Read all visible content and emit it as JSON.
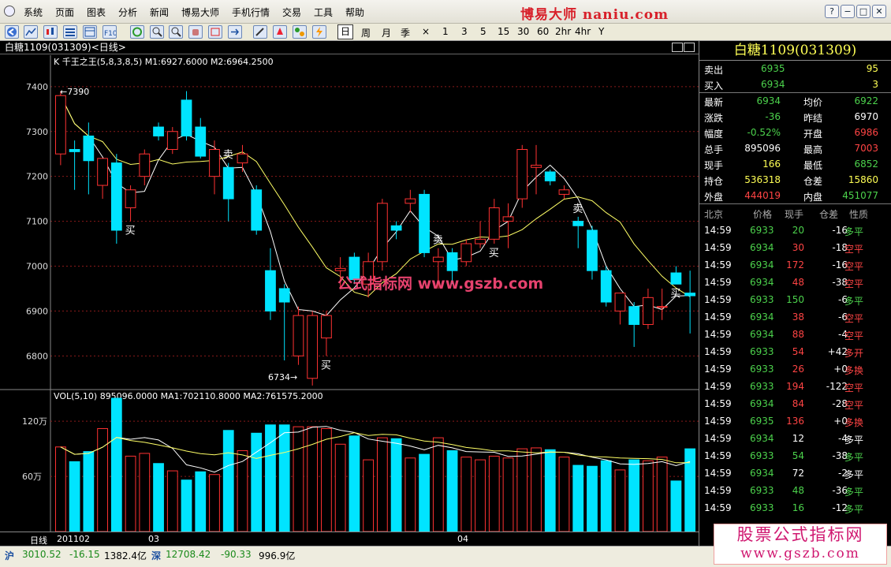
{
  "menu": {
    "items": [
      "系统",
      "页面",
      "图表",
      "分析",
      "新闻",
      "博易大师",
      "手机行情",
      "交易",
      "工具",
      "帮助"
    ],
    "brand": "博易大师 naniu.com"
  },
  "toolbar": {
    "periods": [
      "日",
      "周",
      "月",
      "季",
      "×",
      "1",
      "3",
      "5",
      "15",
      "30",
      "60",
      "2hr",
      "4hr",
      "Y"
    ]
  },
  "chart": {
    "title": "白糖1109(031309)<日线>",
    "kline_label": "K  千王之王(5,8,3,8,5) M1:6927.6000 M2:6964.2500",
    "vol_label": "VOL(5,10) 895096.0000 MA1:702110.8000 MA2:761575.2000",
    "period_label": "日线",
    "date_labels": [
      "201102",
      "03",
      "04"
    ],
    "watermark": "公式指标网 www.gszb.com",
    "high_label": "7390",
    "low_label": "6734"
  },
  "chart_data": {
    "type": "candlestick",
    "y_ticks": [
      7400,
      7300,
      7200,
      7100,
      7000,
      6900,
      6800
    ],
    "ylim": [
      6725,
      7470
    ],
    "vol_ticks": [
      "120万",
      "60万"
    ],
    "vol_tick_values": [
      1200000,
      600000
    ],
    "vol_max": 1450000,
    "candles": [
      {
        "o": 7250,
        "h": 7390,
        "l": 7225,
        "c": 7380
      },
      {
        "o": 7260,
        "h": 7280,
        "l": 7170,
        "c": 7255
      },
      {
        "o": 7290,
        "h": 7320,
        "l": 7160,
        "c": 7235
      },
      {
        "o": 7180,
        "h": 7240,
        "l": 7150,
        "c": 7240
      },
      {
        "o": 7230,
        "h": 7250,
        "l": 7050,
        "c": 7080
      },
      {
        "o": 7130,
        "h": 7180,
        "l": 7100,
        "c": 7170
      },
      {
        "o": 7200,
        "h": 7260,
        "l": 7180,
        "c": 7250
      },
      {
        "o": 7310,
        "h": 7320,
        "l": 7280,
        "c": 7290
      },
      {
        "o": 7260,
        "h": 7310,
        "l": 7250,
        "c": 7300
      },
      {
        "o": 7370,
        "h": 7390,
        "l": 7280,
        "c": 7290
      },
      {
        "o": 7310,
        "h": 7330,
        "l": 7240,
        "c": 7245
      },
      {
        "o": 7200,
        "h": 7280,
        "l": 7160,
        "c": 7260
      },
      {
        "o": 7220,
        "h": 7230,
        "l": 7100,
        "c": 7150
      },
      {
        "o": 7230,
        "h": 7270,
        "l": 7210,
        "c": 7250
      },
      {
        "o": 7170,
        "h": 7180,
        "l": 7070,
        "c": 7080
      },
      {
        "o": 6990,
        "h": 7040,
        "l": 6880,
        "c": 6900
      },
      {
        "o": 6950,
        "h": 6960,
        "l": 6790,
        "c": 6920
      },
      {
        "o": 6800,
        "h": 6910,
        "l": 6780,
        "c": 6890
      },
      {
        "o": 6750,
        "h": 6900,
        "l": 6734,
        "c": 6890
      },
      {
        "o": 6840,
        "h": 6900,
        "l": 6800,
        "c": 6890
      },
      {
        "o": 6990,
        "h": 7020,
        "l": 6950,
        "c": 6995
      },
      {
        "o": 7020,
        "h": 7030,
        "l": 6960,
        "c": 6970
      },
      {
        "o": 6960,
        "h": 7030,
        "l": 6930,
        "c": 7010
      },
      {
        "o": 7010,
        "h": 7150,
        "l": 6990,
        "c": 7140
      },
      {
        "o": 7090,
        "h": 7100,
        "l": 7060,
        "c": 7080
      },
      {
        "o": 7140,
        "h": 7170,
        "l": 7120,
        "c": 7150
      },
      {
        "o": 7160,
        "h": 7170,
        "l": 7020,
        "c": 7030
      },
      {
        "o": 7010,
        "h": 7040,
        "l": 6950,
        "c": 7020
      },
      {
        "o": 7030,
        "h": 7040,
        "l": 6960,
        "c": 6990
      },
      {
        "o": 7010,
        "h": 7060,
        "l": 7000,
        "c": 7050
      },
      {
        "o": 7050,
        "h": 7100,
        "l": 7040,
        "c": 7060
      },
      {
        "o": 7060,
        "h": 7150,
        "l": 7050,
        "c": 7130
      },
      {
        "o": 7100,
        "h": 7140,
        "l": 7040,
        "c": 7110
      },
      {
        "o": 7150,
        "h": 7270,
        "l": 7130,
        "c": 7260
      },
      {
        "o": 7220,
        "h": 7270,
        "l": 7160,
        "c": 7225
      },
      {
        "o": 7210,
        "h": 7215,
        "l": 7180,
        "c": 7190
      },
      {
        "o": 7160,
        "h": 7180,
        "l": 7150,
        "c": 7170
      },
      {
        "o": 7100,
        "h": 7110,
        "l": 7040,
        "c": 7090
      },
      {
        "o": 7080,
        "h": 7090,
        "l": 6970,
        "c": 6990
      },
      {
        "o": 6990,
        "h": 7000,
        "l": 6910,
        "c": 6920
      },
      {
        "o": 6900,
        "h": 6940,
        "l": 6870,
        "c": 6940
      },
      {
        "o": 6910,
        "h": 6920,
        "l": 6820,
        "c": 6870
      },
      {
        "o": 6870,
        "h": 6950,
        "l": 6860,
        "c": 6930
      },
      {
        "o": 6910,
        "h": 6950,
        "l": 6880,
        "c": 6910
      },
      {
        "o": 6985,
        "h": 7000,
        "l": 6960,
        "c": 6960
      },
      {
        "o": 6940,
        "h": 6990,
        "l": 6850,
        "c": 6934
      }
    ],
    "up_color": "#ff3232",
    "down_color": "#00e4ff",
    "ma_colors": [
      "#ffffff",
      "#ffff66"
    ],
    "volumes": [
      920000,
      760000,
      870000,
      1120000,
      1450000,
      820000,
      850000,
      740000,
      660000,
      560000,
      650000,
      620000,
      1100000,
      880000,
      1070000,
      1160000,
      1160000,
      1140000,
      1140000,
      1120000,
      950000,
      1040000,
      780000,
      1020000,
      1010000,
      800000,
      840000,
      1020000,
      880000,
      810000,
      780000,
      820000,
      800000,
      900000,
      910000,
      890000,
      810000,
      720000,
      710000,
      770000,
      670000,
      780000,
      770000,
      810000,
      550000,
      900000
    ],
    "signals": [
      {
        "i": 5,
        "text": "买",
        "pos": "below"
      },
      {
        "i": 12,
        "text": "卖",
        "pos": "above"
      },
      {
        "i": 19,
        "text": "买",
        "pos": "below"
      },
      {
        "i": 27,
        "text": "卖",
        "pos": "above"
      },
      {
        "i": 31,
        "text": "买",
        "pos": "below"
      },
      {
        "i": 37,
        "text": "卖",
        "pos": "above"
      },
      {
        "i": 44,
        "text": "买",
        "pos": "below"
      }
    ]
  },
  "quote": {
    "title": "白糖1109(031309)",
    "ask": {
      "label": "卖出",
      "price": "6935",
      "vol": "95"
    },
    "bid": {
      "label": "买入",
      "price": "6934",
      "vol": "3"
    },
    "stats": [
      {
        "l1": "最新",
        "v1": "6934",
        "c1": "#4cd24c",
        "l2": "均价",
        "v2": "6922",
        "c2": "#4cd24c"
      },
      {
        "l1": "涨跌",
        "v1": "-36",
        "c1": "#4cd24c",
        "l2": "昨结",
        "v2": "6970",
        "c2": "#ffffff"
      },
      {
        "l1": "幅度",
        "v1": "-0.52%",
        "c1": "#4cd24c",
        "l2": "开盘",
        "v2": "6986",
        "c2": "#ff4444"
      },
      {
        "l1": "总手",
        "v1": "895096",
        "c1": "#ffffff",
        "l2": "最高",
        "v2": "7003",
        "c2": "#ff4444"
      },
      {
        "l1": "现手",
        "v1": "166",
        "c1": "#ffff55",
        "l2": "最低",
        "v2": "6852",
        "c2": "#4cd24c"
      },
      {
        "l1": "持仓",
        "v1": "536318",
        "c1": "#ffff55",
        "l2": "仓差",
        "v2": "15860",
        "c2": "#ffff55"
      },
      {
        "l1": "外盘",
        "v1": "444019",
        "c1": "#ff4444",
        "l2": "内盘",
        "v2": "451077",
        "c2": "#4cd24c"
      }
    ],
    "tick_headers": [
      "北京",
      "价格",
      "现手",
      "仓差",
      "性质"
    ],
    "ticks": [
      {
        "t": "14:59",
        "p": "6933",
        "v": "20",
        "d": "-16",
        "n": "多平"
      },
      {
        "t": "14:59",
        "p": "6934",
        "v": "30",
        "d": "-18",
        "n": "空平"
      },
      {
        "t": "14:59",
        "p": "6934",
        "v": "172",
        "d": "-16",
        "n": "空平"
      },
      {
        "t": "14:59",
        "p": "6934",
        "v": "48",
        "d": "-38",
        "n": "空平"
      },
      {
        "t": "14:59",
        "p": "6933",
        "v": "150",
        "d": "-6",
        "n": "多平"
      },
      {
        "t": "14:59",
        "p": "6934",
        "v": "38",
        "d": "-6",
        "n": "空平"
      },
      {
        "t": "14:59",
        "p": "6934",
        "v": "88",
        "d": "-4",
        "n": "空平"
      },
      {
        "t": "14:59",
        "p": "6933",
        "v": "54",
        "d": "+42",
        "n": "多开"
      },
      {
        "t": "14:59",
        "p": "6933",
        "v": "26",
        "d": "+0",
        "n": "多换"
      },
      {
        "t": "14:59",
        "p": "6933",
        "v": "194",
        "d": "-122",
        "n": "空平"
      },
      {
        "t": "14:59",
        "p": "6934",
        "v": "84",
        "d": "-28",
        "n": "空平"
      },
      {
        "t": "14:59",
        "p": "6935",
        "v": "136",
        "d": "+0",
        "n": "多换"
      },
      {
        "t": "14:59",
        "p": "6934",
        "v": "12",
        "d": "-4",
        "n": "多平"
      },
      {
        "t": "14:59",
        "p": "6933",
        "v": "54",
        "d": "-38",
        "n": "多平"
      },
      {
        "t": "14:59",
        "p": "6934",
        "v": "72",
        "d": "-2",
        "n": "多平"
      },
      {
        "t": "14:59",
        "p": "6933",
        "v": "48",
        "d": "-36",
        "n": "多平"
      },
      {
        "t": "14:59",
        "p": "6933",
        "v": "16",
        "d": "-12",
        "n": "多平"
      }
    ],
    "tick_colors": {
      "p": "#4cd24c",
      "v_red": "#ff4444",
      "v_white": "#ffffff"
    }
  },
  "status": {
    "sh_label": "沪",
    "sh_index": "3010.52",
    "sh_change": "-16.15",
    "sh_amount": "1382.4亿",
    "sz_label": "深",
    "sz_index": "12708.42",
    "sz_change": "-90.33",
    "sz_amount": "996.9亿"
  },
  "watermark2": {
    "line1": "股票公式指标网",
    "line2": "www.gszb.com"
  }
}
